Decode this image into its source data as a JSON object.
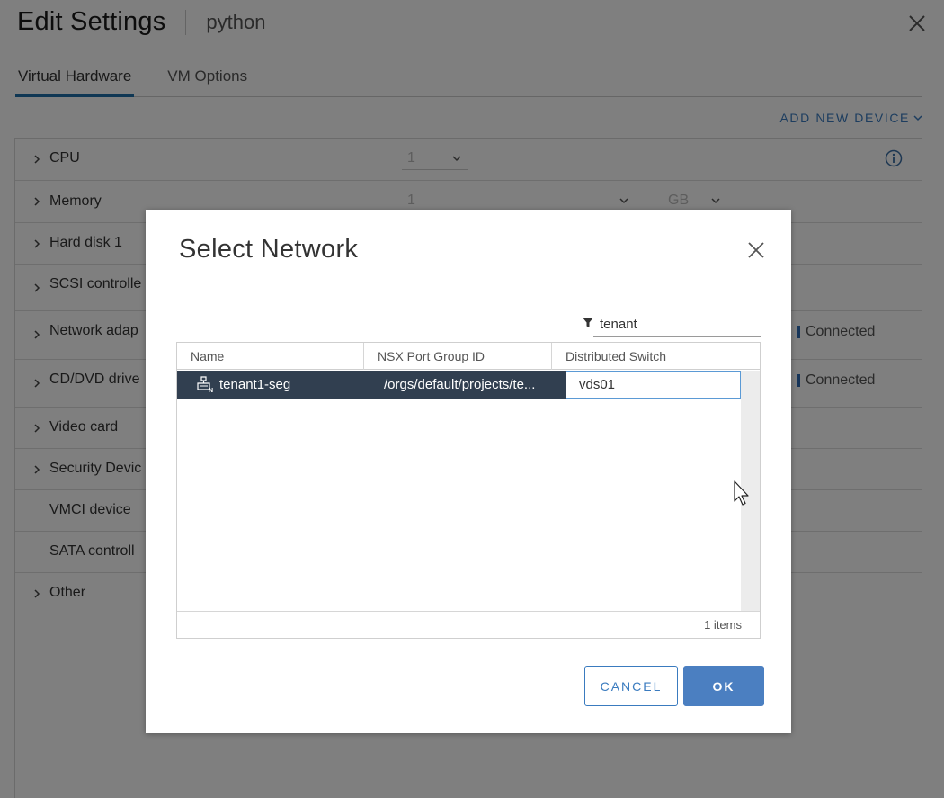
{
  "background": {
    "title": "Edit Settings",
    "vm_name": "python",
    "tabs": [
      {
        "label": "Virtual Hardware",
        "active": true
      },
      {
        "label": "VM Options",
        "active": false
      }
    ],
    "add_device_label": "ADD NEW DEVICE",
    "hardware": [
      {
        "label": "CPU",
        "value": "1",
        "expandable": true
      },
      {
        "label": "Memory",
        "value": "1",
        "unit": "GB",
        "expandable": true
      },
      {
        "label": "Hard disk 1",
        "expandable": true
      },
      {
        "label": "SCSI controlle",
        "expandable": true
      },
      {
        "label": "Network adap",
        "status": "Connected",
        "expandable": true
      },
      {
        "label": "CD/DVD drive",
        "status": "Connected",
        "expandable": true
      },
      {
        "label": "Video card",
        "expandable": true
      },
      {
        "label": "Security Devic",
        "expandable": true
      },
      {
        "label": "VMCI device",
        "expandable": false
      },
      {
        "label": "SATA controll",
        "expandable": false
      },
      {
        "label": "Other",
        "expandable": true
      }
    ]
  },
  "dialog": {
    "title": "Select Network",
    "filter_value": "tenant",
    "columns": [
      "Name",
      "NSX Port Group ID",
      "Distributed Switch"
    ],
    "rows": [
      {
        "name": "tenant1-seg",
        "port_group": "/orgs/default/projects/te...",
        "switch": "vds01"
      }
    ],
    "footer": "1 items",
    "cancel_label": "CANCEL",
    "ok_label": "OK"
  },
  "colors": {
    "accent": "#3a7bbf",
    "selected_row": "#313f50",
    "ok_button": "#4b7fc1",
    "tab_underline": "#1f6fa8"
  }
}
